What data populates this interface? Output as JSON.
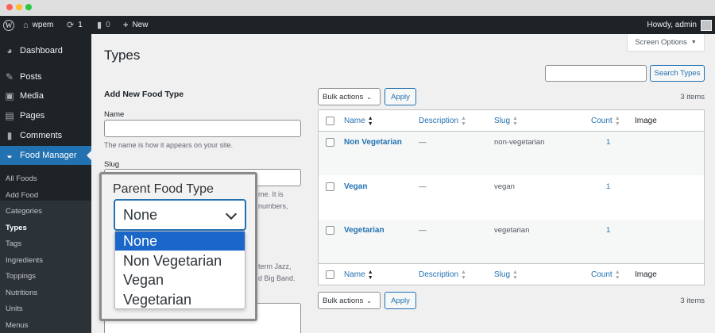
{
  "adminbar": {
    "site_name": "wpem",
    "updates_count": "1",
    "comments_count": "0",
    "new_label": "New",
    "howdy": "Howdy, admin"
  },
  "sidebar": {
    "items": [
      {
        "label": "Dashboard",
        "icon": "dashboard-icon"
      },
      {
        "label": "Posts",
        "icon": "pin-icon"
      },
      {
        "label": "Media",
        "icon": "media-icon"
      },
      {
        "label": "Pages",
        "icon": "pages-icon"
      },
      {
        "label": "Comments",
        "icon": "comment-icon"
      },
      {
        "label": "Food Manager",
        "icon": "food-manager-icon"
      }
    ],
    "submenu": [
      "All Foods",
      "Add Food",
      "Categories",
      "Types",
      "Tags",
      "Ingredients",
      "Toppings",
      "Nutritions",
      "Units",
      "Menus"
    ]
  },
  "screen_options": "Screen Options",
  "page_title": "Types",
  "search": {
    "button": "Search Types"
  },
  "form": {
    "title": "Add New Food Type",
    "name_label": "Name",
    "name_help": "The name is how it appears on your site.",
    "slug_label": "Slug",
    "slug_help_frag1": "me. It is",
    "slug_help_frag2": "numbers,",
    "desc_help_frag1": "term Jazz,",
    "desc_help_frag2": "d Big Band."
  },
  "dropdown": {
    "label": "Parent Food Type",
    "selected": "None",
    "options": [
      "None",
      "Non Vegetarian",
      "Vegan",
      "Vegetarian"
    ]
  },
  "table": {
    "bulk_actions": "Bulk actions",
    "apply": "Apply",
    "items_count": "3 items",
    "columns": [
      "Name",
      "Description",
      "Slug",
      "Count",
      "Image"
    ],
    "rows": [
      {
        "name": "Non Vegetarian",
        "description": "—",
        "slug": "non-vegetarian",
        "count": "1"
      },
      {
        "name": "Vegan",
        "description": "—",
        "slug": "vegan",
        "count": "1"
      },
      {
        "name": "Vegetarian",
        "description": "—",
        "slug": "vegetarian",
        "count": "1"
      }
    ]
  },
  "colors": {
    "accent": "#2271b1",
    "admin_dark": "#1d2327",
    "selected_option": "#1a66c9"
  }
}
